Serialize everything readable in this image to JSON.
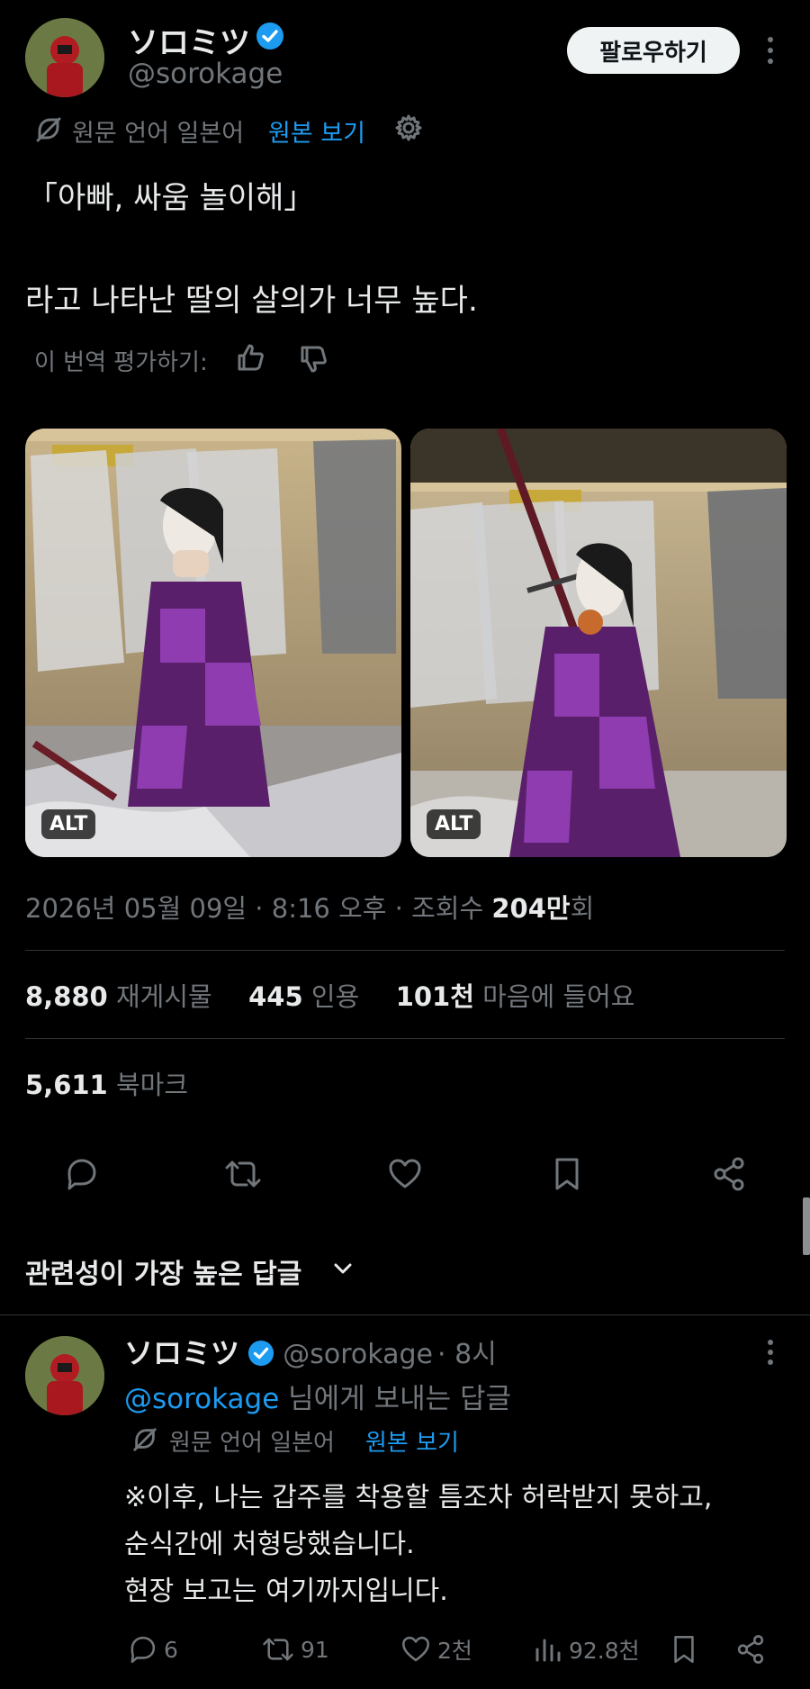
{
  "tweet": {
    "author_name": "ソロミツ",
    "author_handle": "@sorokage",
    "follow_label": "팔로우하기",
    "translation_note": "원문 언어 일본어",
    "show_original": "원본 보기",
    "text_line1": "「아빠, 싸움 놀이해」",
    "text_line2": "라고 나타난 딸의 살의가 너무 높다.",
    "rate_translation": "이 번역 평가하기:",
    "alt_label": "ALT",
    "datetime": "2026년 05월 09일 · 8:16 오후 · 조회수 ",
    "views_num": "204만",
    "views_suffix": "회",
    "retweets_num": "8,880",
    "retweets_label": "재게시물",
    "quotes_num": "445",
    "quotes_label": "인용",
    "likes_num": "101천",
    "likes_label": "마음에 들어요",
    "bookmarks_num": "5,611",
    "bookmarks_label": "북마크"
  },
  "replies_sort_label": "관련성이 가장 높은 답글",
  "reply": {
    "author_name": "ソロミツ",
    "author_handle": "@sorokage",
    "time": "· 8시",
    "reply_to_handle": "@sorokage",
    "reply_to_suffix": " 님에게 보내는 답글",
    "translation_note": "원문 언어 일본어",
    "show_original": "원본 보기",
    "text_line1": "※이후, 나는 갑주를 착용할 틈조차 허락받지 못하고,",
    "text_line2": "순식간에 처형당했습니다.",
    "text_line3": "현장 보고는 여기까지입니다.",
    "replies_count": "6",
    "retweets_count": "91",
    "likes_count": "2천",
    "views_count": "92.8천"
  },
  "colors": {
    "accent": "#1d9bf0",
    "muted": "#71767b",
    "text": "#e7e9ea",
    "background": "#000000"
  }
}
